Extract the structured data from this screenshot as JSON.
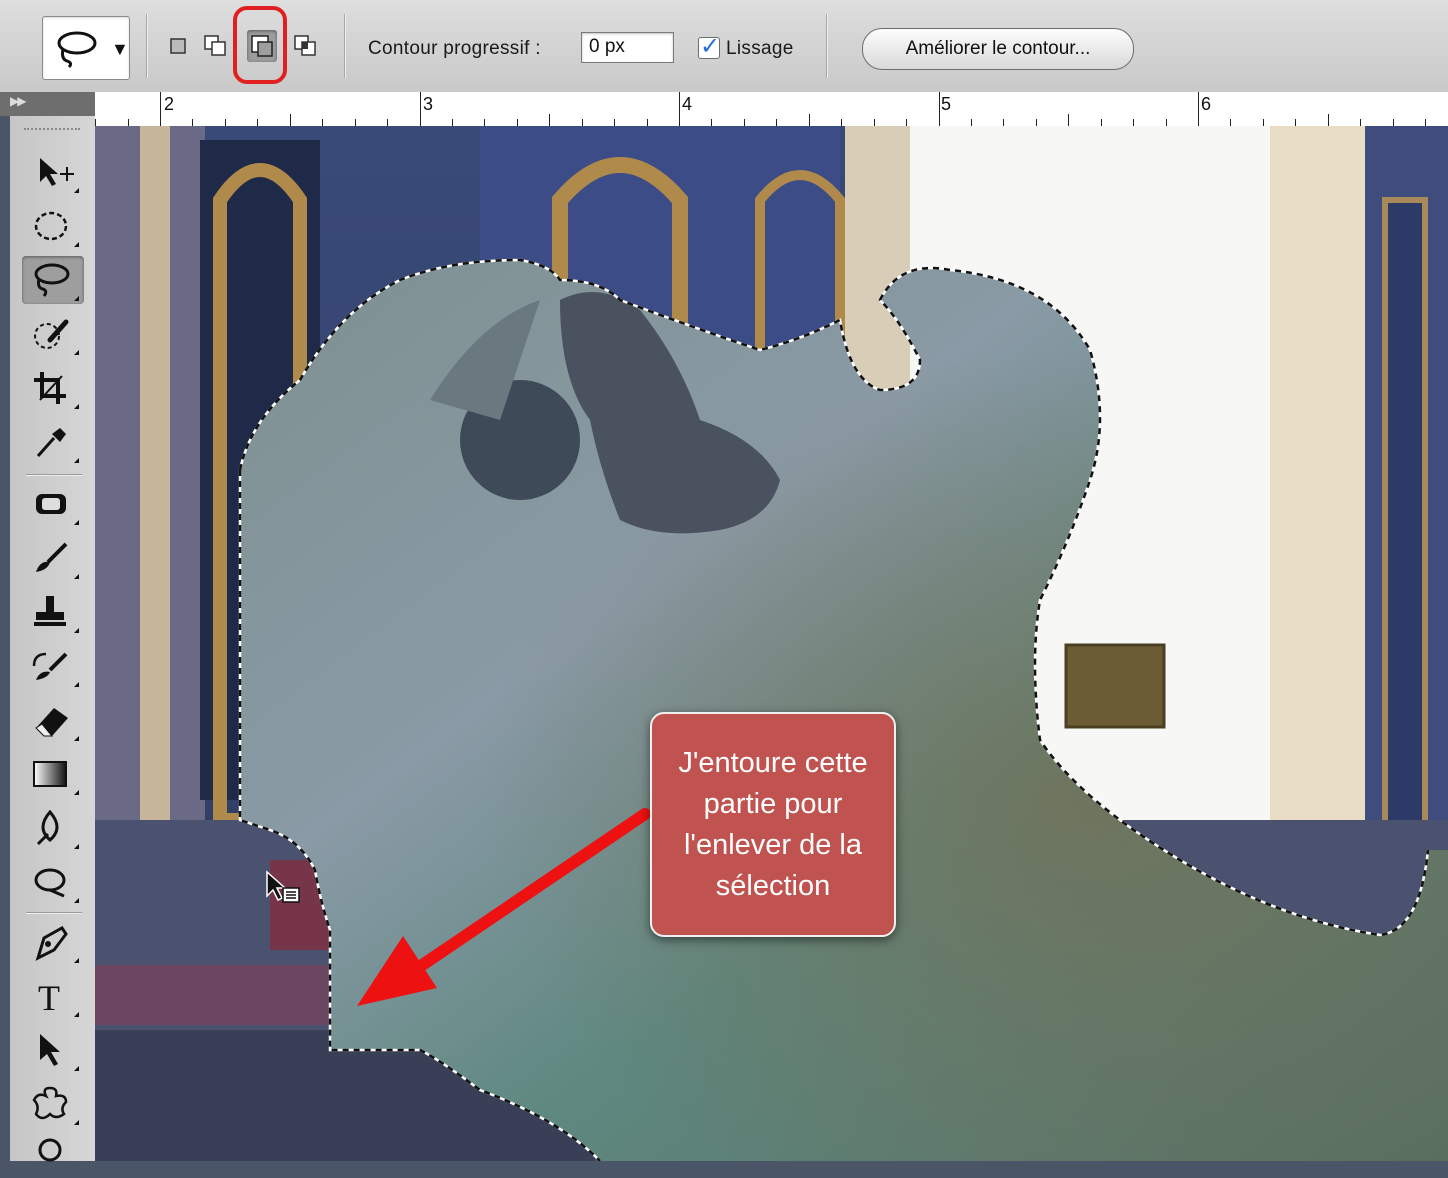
{
  "options_bar": {
    "tool_preset_icon": "lasso-icon",
    "selection_modes": [
      "new-selection-icon",
      "add-to-selection-icon",
      "subtract-from-selection-icon",
      "intersect-selection-icon"
    ],
    "active_mode": "subtract-from-selection-icon",
    "feather_label": "Contour progressif :",
    "feather_value": "0 px",
    "antialias_label": "Lissage",
    "antialias_checked": true,
    "refine_edge_label": "Améliorer le contour..."
  },
  "ruler": {
    "labels": [
      "2",
      "3",
      "4",
      "5",
      "6"
    ]
  },
  "tools": [
    "move-icon",
    "marquee-icon",
    "lasso-icon",
    "quick-selection-icon",
    "crop-icon",
    "eyedropper-icon",
    "healing-brush-icon",
    "brush-icon",
    "clone-stamp-icon",
    "history-brush-icon",
    "eraser-icon",
    "gradient-icon",
    "blur-icon",
    "dodge-icon",
    "pen-icon",
    "type-icon",
    "path-selection-icon",
    "shape-icon",
    "zoom-icon"
  ],
  "active_tool": "lasso-icon",
  "annotation": {
    "text": "J'entoure cette partie pour l'enlever de la sélection",
    "bg_color": "#c05250",
    "arrow_color": "#ee1111"
  },
  "highlight_color": "#e02020"
}
